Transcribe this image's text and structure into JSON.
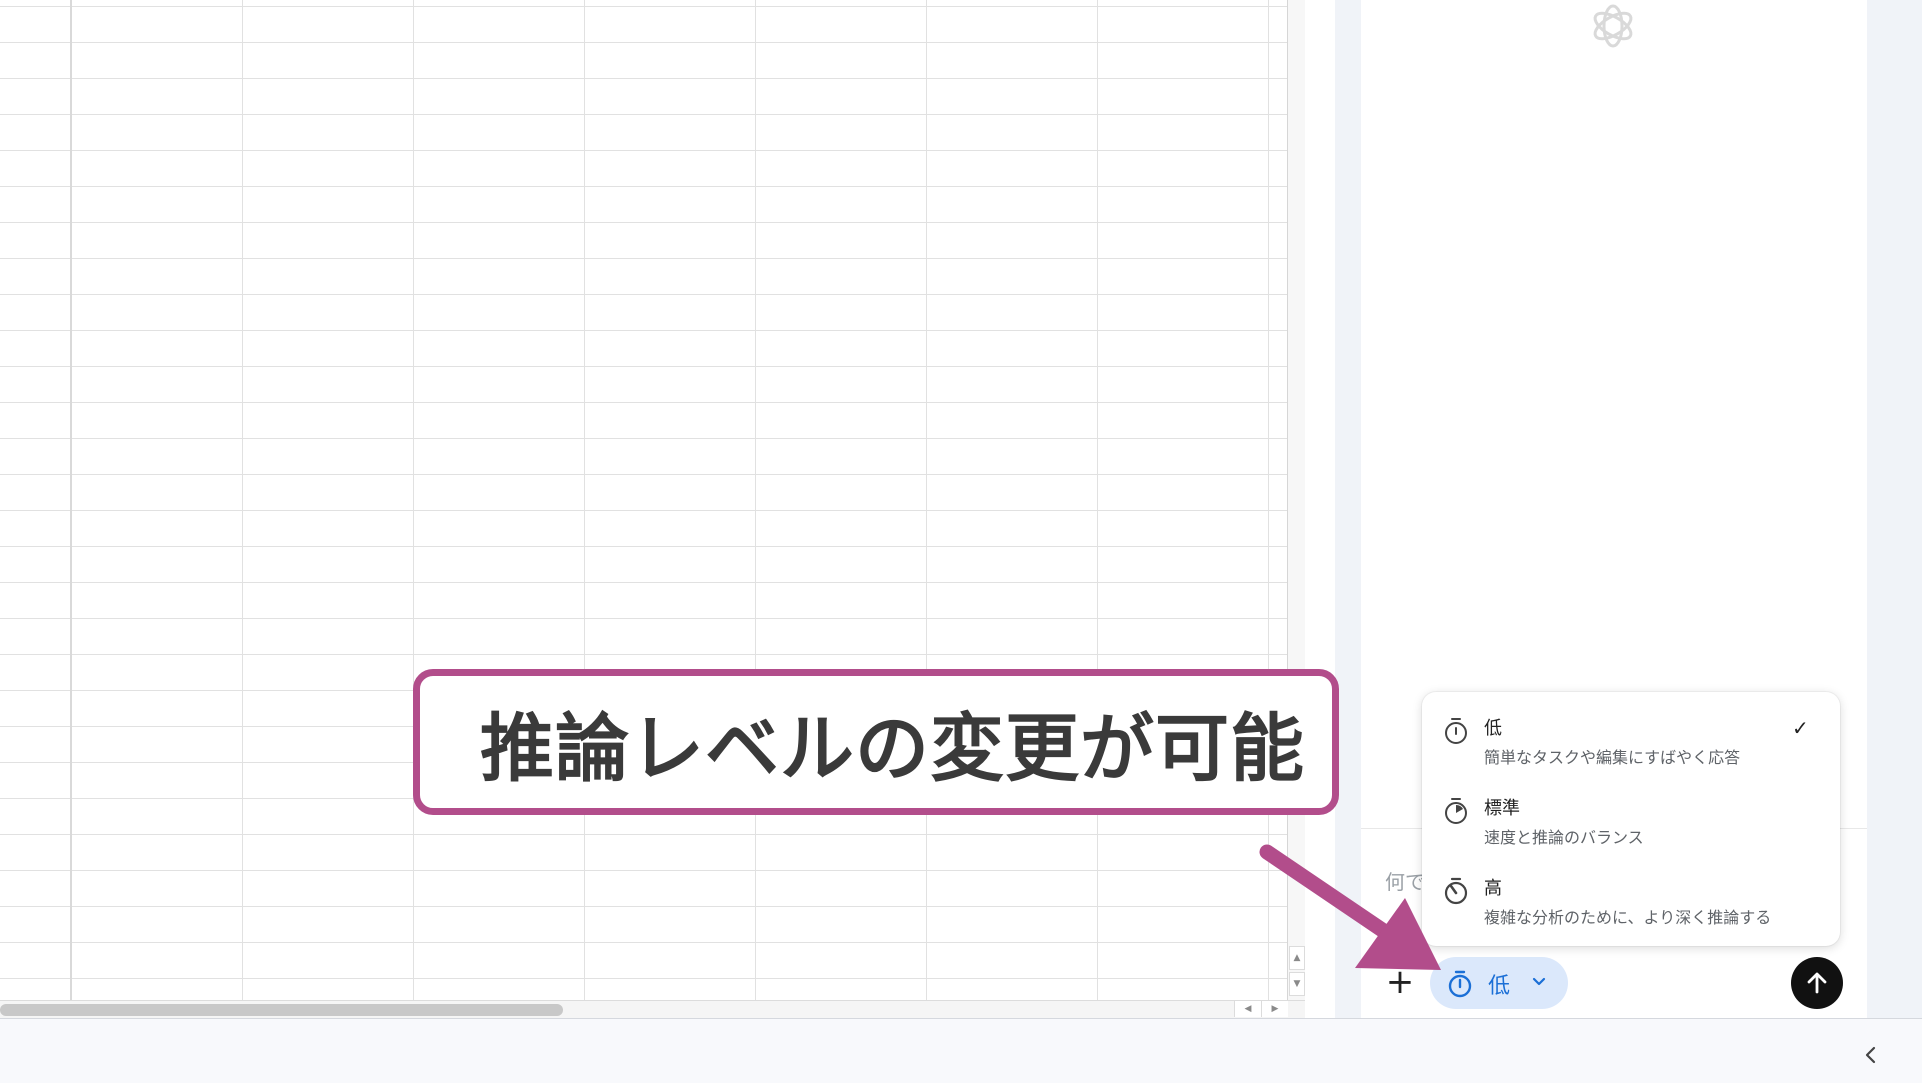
{
  "sheet": {
    "scroll_up_icon": "triangle-up",
    "scroll_down_icon": "triangle-down",
    "scroll_left_icon": "triangle-left",
    "scroll_right_icon": "triangle-right"
  },
  "chat": {
    "logo_icon": "openai-logo",
    "input_placeholder": "何で",
    "plus_label": "+",
    "level_chip": {
      "label": "低",
      "icon": "stopwatch-icon",
      "accent": "#1b6fd6",
      "background": "#dbe8fb"
    },
    "send_icon": "arrow-up"
  },
  "level_menu": {
    "items": [
      {
        "title": "低",
        "description": "簡単なタスクや編集にすばやく応答",
        "selected": true
      },
      {
        "title": "標準",
        "description": "速度と推論のバランス",
        "selected": false
      },
      {
        "title": "高",
        "description": "複雑な分析のために、より深く推論する",
        "selected": false
      }
    ],
    "check_mark": "✓"
  },
  "callout": {
    "text": "推論レベルの変更が可能",
    "border_color": "#b24d8b"
  },
  "bottom_bar": {
    "collapse_icon": "chevron-left"
  }
}
